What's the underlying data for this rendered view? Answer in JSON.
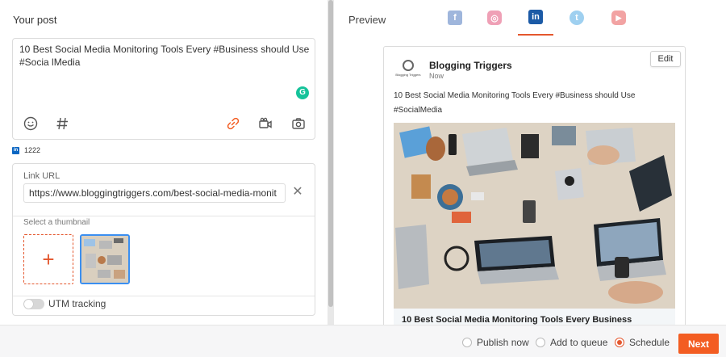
{
  "composer": {
    "title": "Your post",
    "post_text_line1": "10 Best Social Media Monitoring Tools Every #Business should Use",
    "post_text_line2": "#Socia lMedia",
    "grammarly_icon": "grammarly-icon",
    "tools": [
      "emoji-icon",
      "hashtag-icon",
      "link-icon",
      "video-icon",
      "camera-icon"
    ],
    "char_count": "1222",
    "network_icon": "linkedin-icon",
    "link": {
      "label": "Link URL",
      "url": "https://www.bloggingtriggers.com/best-social-media-monit",
      "thumbnail_label": "Select a thumbnail",
      "add_symbol": "+"
    },
    "utm": {
      "label": "UTM tracking",
      "enabled": false
    }
  },
  "preview": {
    "label": "Preview",
    "tabs": [
      {
        "icon": "facebook-icon",
        "glyph": "f",
        "color": "#9fb6dc",
        "active": false
      },
      {
        "icon": "instagram-icon",
        "glyph": "◎",
        "color": "#efa0b6",
        "active": false
      },
      {
        "icon": "linkedin-icon",
        "glyph": "in",
        "color": "#1b5aa6",
        "active": true
      },
      {
        "icon": "twitter-icon",
        "glyph": "t",
        "color": "#9fd0f0",
        "active": false
      },
      {
        "icon": "youtube-icon",
        "glyph": "▶",
        "color": "#f2a3a3",
        "active": false
      }
    ],
    "card": {
      "edit_label": "Edit",
      "logo_text": "Blogging Triggers",
      "author": "Blogging Triggers",
      "time": "Now",
      "caption": "10 Best Social Media Monitoring Tools Every #Business should Use #SocialMedia",
      "link_title": "10 Best Social Media Monitoring Tools Every Business"
    }
  },
  "footer": {
    "options": [
      {
        "label": "Publish now",
        "selected": false
      },
      {
        "label": "Add to queue",
        "selected": false
      },
      {
        "label": "Schedule",
        "selected": true
      }
    ],
    "next_label": "Next"
  },
  "colors": {
    "accent": "#f35d22",
    "linkedin": "#0a66c2"
  }
}
